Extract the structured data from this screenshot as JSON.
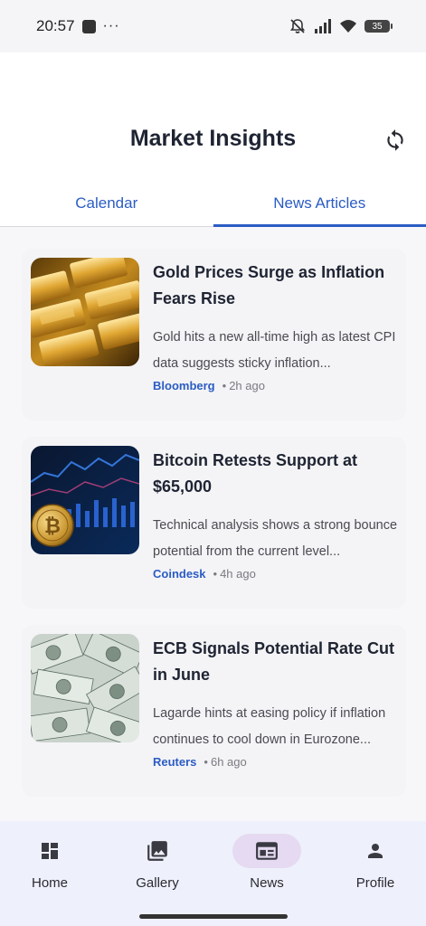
{
  "status_bar": {
    "time": "20:57",
    "battery": "35"
  },
  "header": {
    "title": "Market Insights"
  },
  "tabs": [
    {
      "label": "Calendar",
      "active": false
    },
    {
      "label": "News Articles",
      "active": true
    }
  ],
  "articles": [
    {
      "title": "Gold Prices Surge as Inflation Fears Rise",
      "description": "Gold hits a new all-time high as latest CPI data suggests sticky inflation...",
      "source": "Bloomberg",
      "time": "2h ago",
      "image": "gold-bars-image"
    },
    {
      "title": "Bitcoin Retests Support at $65,000",
      "description": "Technical analysis shows a strong bounce potential from the current level...",
      "source": "Coindesk",
      "time": "4h ago",
      "image": "bitcoin-chart-image"
    },
    {
      "title": "ECB Signals Potential Rate Cut in June",
      "description": "Lagarde hints at easing policy if inflation continues to cool down in Eurozone...",
      "source": "Reuters",
      "time": "6h ago",
      "image": "dollar-bills-image"
    }
  ],
  "bottom_nav": [
    {
      "label": "Home",
      "icon": "dashboard-icon",
      "active": false
    },
    {
      "label": "Gallery",
      "icon": "gallery-icon",
      "active": false
    },
    {
      "label": "News",
      "icon": "newspaper-icon",
      "active": true
    },
    {
      "label": "Profile",
      "icon": "person-icon",
      "active": false
    }
  ],
  "colors": {
    "accent": "#2b5cc4",
    "nav_background": "#eef0fb",
    "active_pill": "#e5daf2"
  }
}
